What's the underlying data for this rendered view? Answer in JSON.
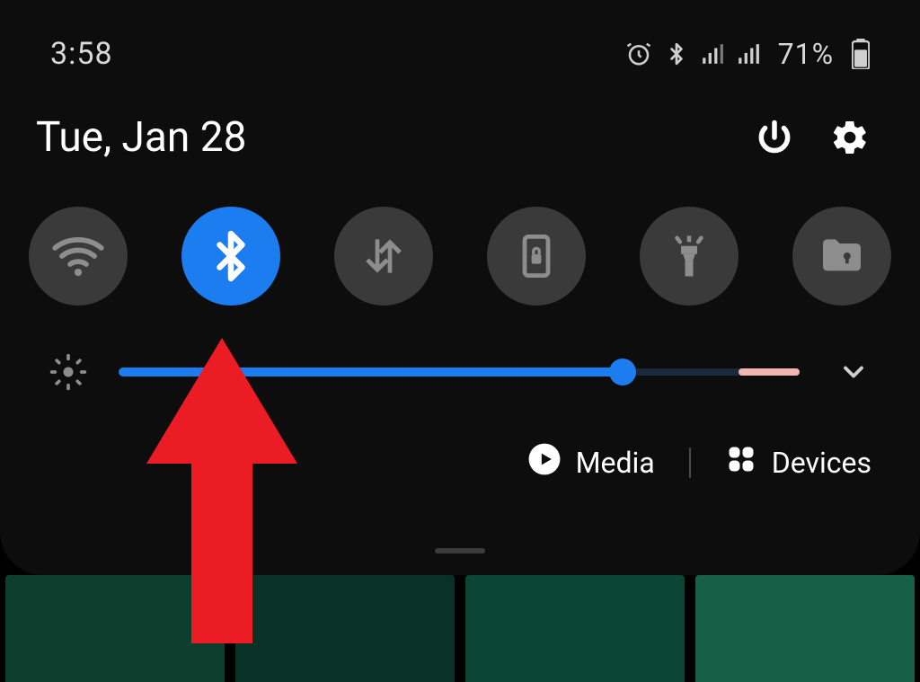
{
  "status_bar": {
    "time": "3:58",
    "battery_pct": "71%"
  },
  "header": {
    "date": "Tue, Jan 28"
  },
  "quick_settings": {
    "tiles": [
      {
        "name": "wifi",
        "on": false
      },
      {
        "name": "bluetooth",
        "on": true
      },
      {
        "name": "mobiledata",
        "on": false
      },
      {
        "name": "rotationlock",
        "on": false
      },
      {
        "name": "flashlight",
        "on": false
      },
      {
        "name": "securefolder",
        "on": false
      }
    ]
  },
  "brightness": {
    "value_pct": 74
  },
  "bottom_shortcuts": {
    "media_label": "Media",
    "devices_label": "Devices"
  },
  "annotation": {
    "desc": "Large red upward arrow pointing at the Bluetooth quick-settings tile"
  }
}
